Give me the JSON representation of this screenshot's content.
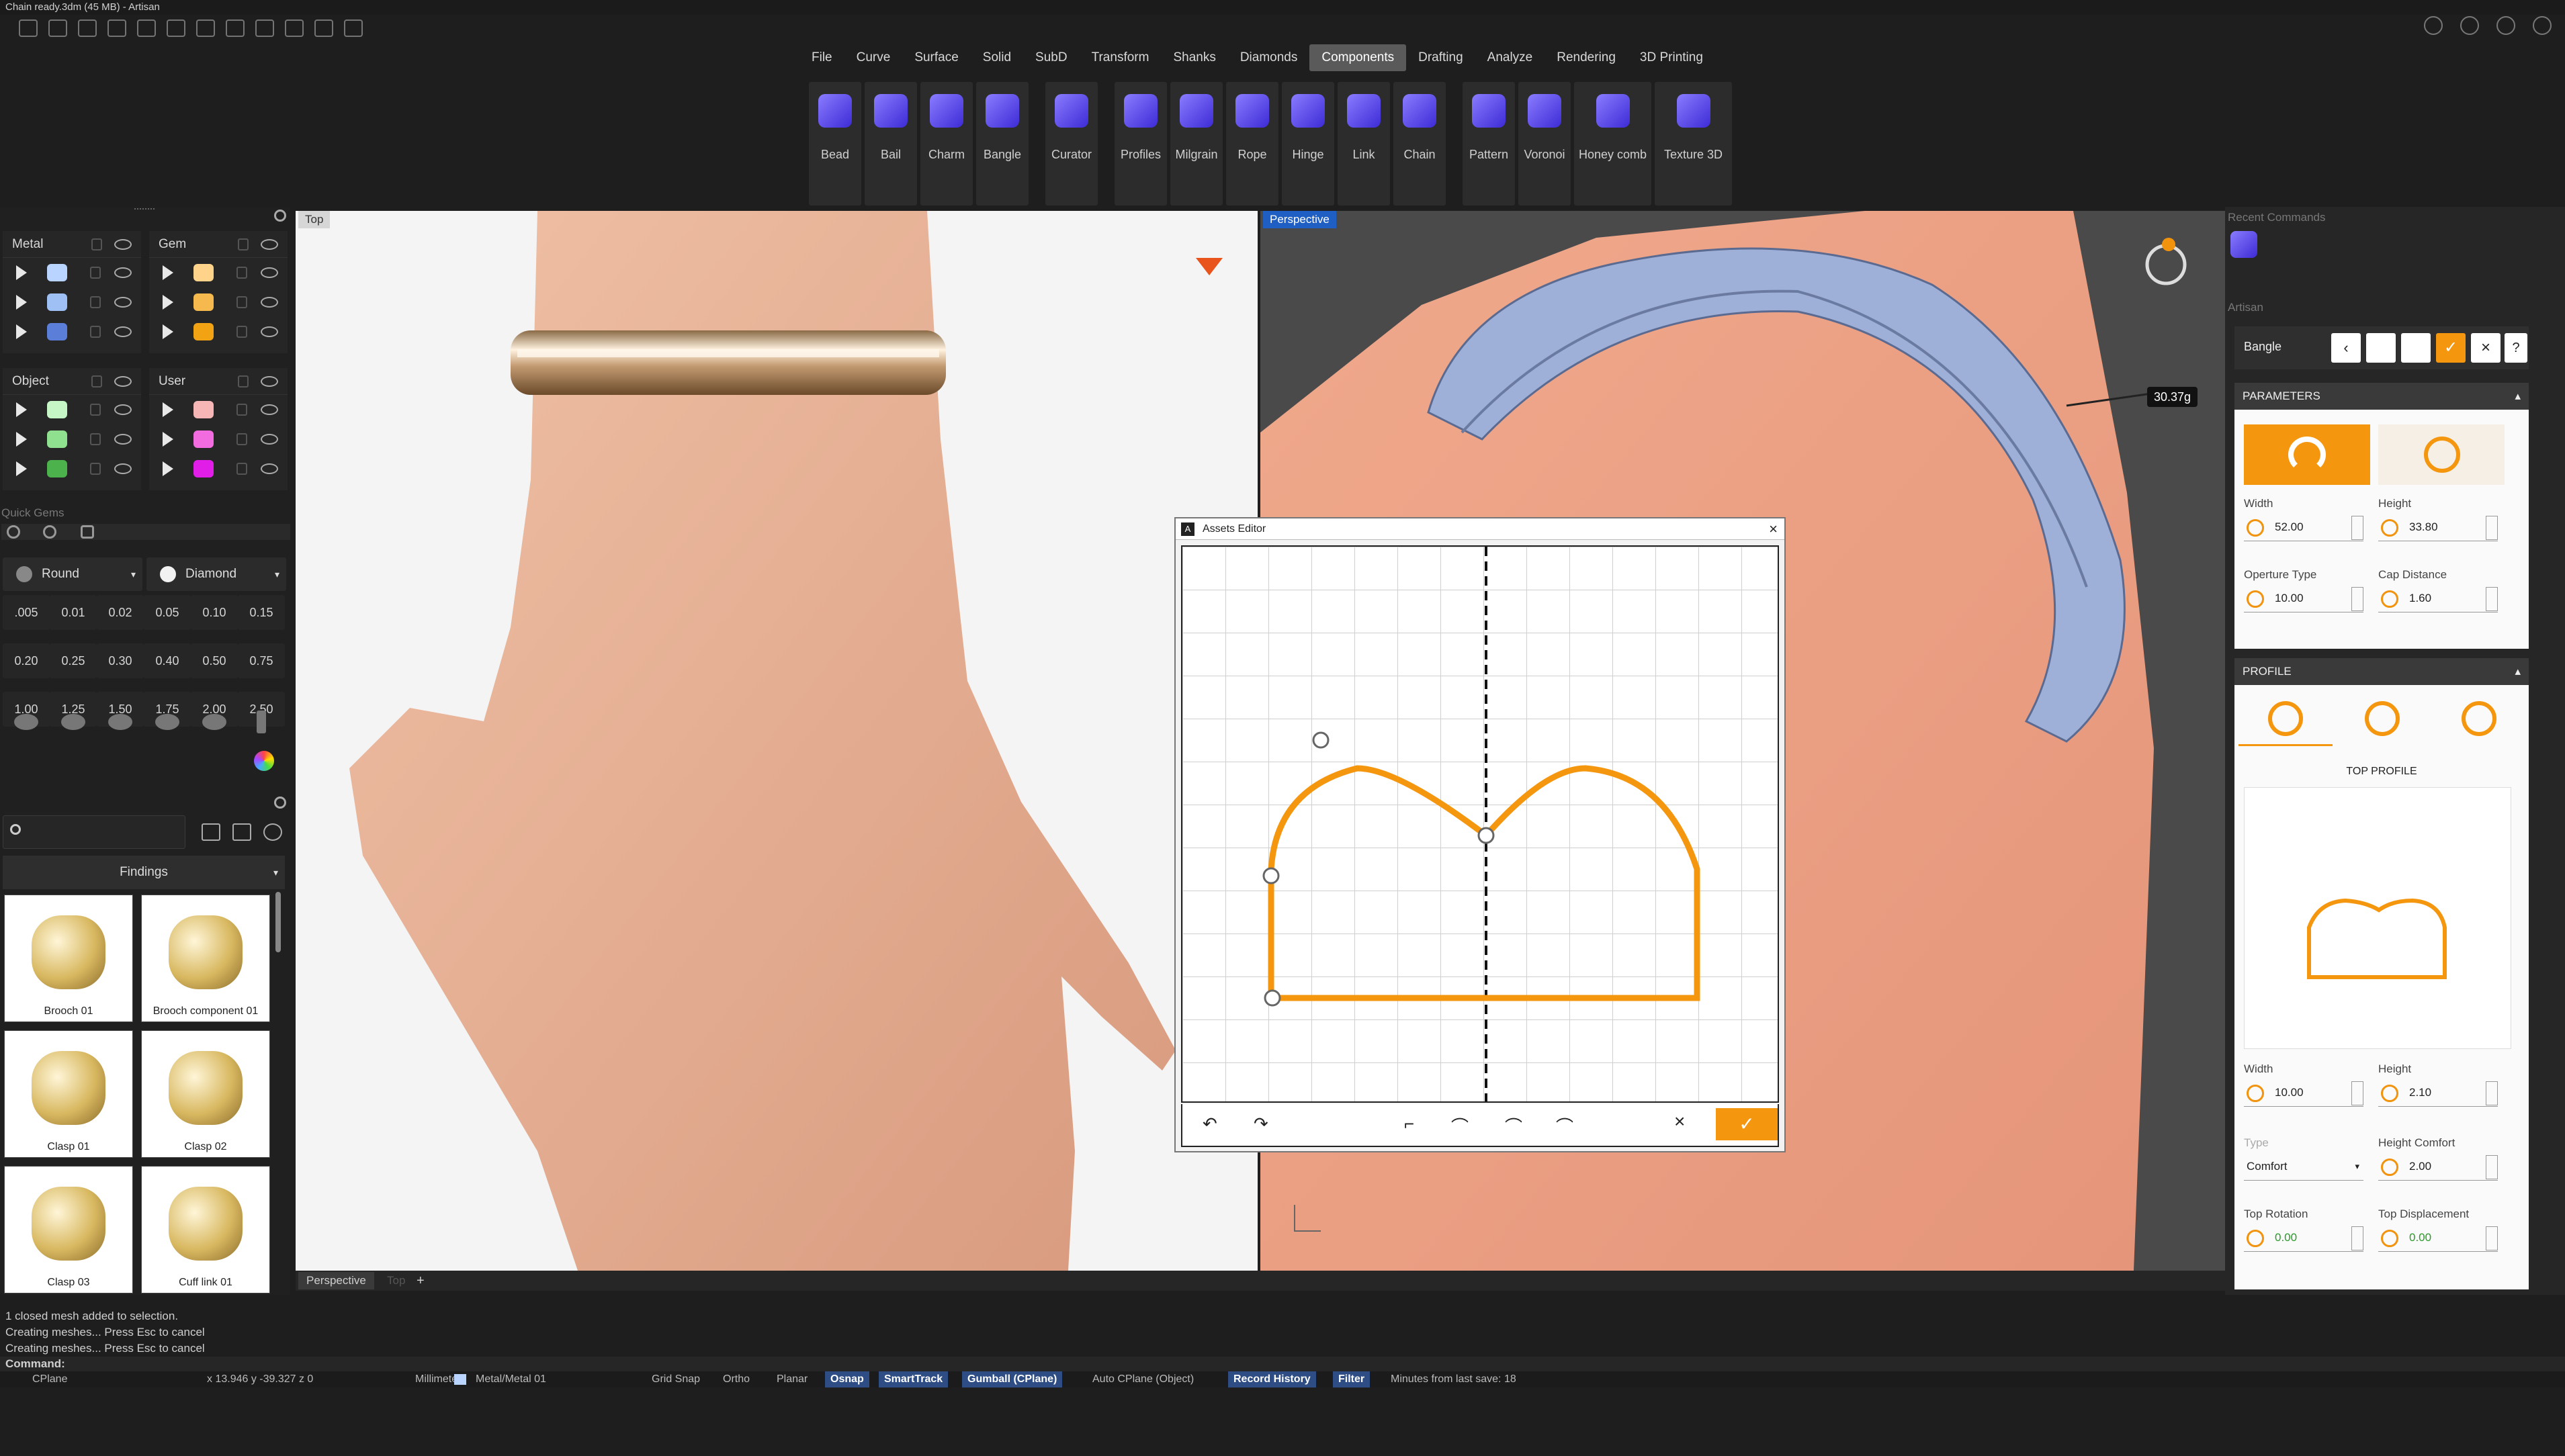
{
  "window": {
    "title": "Chain ready.3dm (45 MB) - Artisan"
  },
  "menu": [
    "File",
    "Curve",
    "Surface",
    "Solid",
    "SubD",
    "Transform",
    "Shanks",
    "Diamonds",
    "Components",
    "Drafting",
    "Analyze",
    "Rendering",
    "3D Printing"
  ],
  "menu_active": "Components",
  "toolbar": [
    {
      "label": "Bead",
      "group": 1
    },
    {
      "label": "Bail",
      "group": 1
    },
    {
      "label": "Charm",
      "group": 1
    },
    {
      "label": "Bangle",
      "group": 1
    },
    {
      "label": "Curator",
      "group": 2
    },
    {
      "label": "Profiles",
      "group": 3
    },
    {
      "label": "Milgrain",
      "group": 3
    },
    {
      "label": "Rope",
      "group": 3
    },
    {
      "label": "Hinge",
      "group": 3
    },
    {
      "label": "Link",
      "group": 3
    },
    {
      "label": "Chain",
      "group": 3
    },
    {
      "label": "Pattern",
      "group": 4
    },
    {
      "label": "Voronoi",
      "group": 4
    },
    {
      "label": "Honey comb",
      "group": 4,
      "wide": true
    },
    {
      "label": "Texture 3D",
      "group": 4,
      "wide": true
    }
  ],
  "layers": {
    "metal": {
      "title": "Metal",
      "colors": [
        "#b9d4ff",
        "#9fc0f5",
        "#5b7fd9"
      ]
    },
    "gem": {
      "title": "Gem",
      "colors": [
        "#ffd38a",
        "#f5b94d",
        "#f2a313"
      ]
    },
    "object": {
      "title": "Object",
      "colors": [
        "#c6f5c6",
        "#8fe08f",
        "#4cb34c"
      ]
    },
    "user": {
      "title": "User",
      "colors": [
        "#f7b6b6",
        "#f26ce0",
        "#e01ee8"
      ]
    }
  },
  "quick_gems": {
    "title": "Quick Gems",
    "shape": "Round",
    "cut": "Diamond",
    "sizes": [
      ".005",
      "0.01",
      "0.02",
      "0.05",
      "0.10",
      "0.15",
      "0.20",
      "0.25",
      "0.30",
      "0.40",
      "0.50",
      "0.75",
      "1.00",
      "1.25",
      "1.50",
      "1.75",
      "2.00",
      "2.50"
    ]
  },
  "library": {
    "category": "Findings",
    "items": [
      "Brooch 01",
      "Brooch component 01",
      "Clasp 01",
      "Clasp 02",
      "Clasp 03",
      "Cuff link 01"
    ]
  },
  "viewports": {
    "left_label": "Top",
    "right_label": "Perspective",
    "weight_label": "30.37g",
    "tabs": [
      "Perspective",
      "Top"
    ]
  },
  "assets_editor": {
    "title": "Assets Editor"
  },
  "right_panel": {
    "recent_title": "Recent Commands",
    "artisan_title": "Artisan",
    "command": "Bangle",
    "parameters": {
      "title": "PARAMETERS",
      "width_label": "Width",
      "width": "52.00",
      "height_label": "Height",
      "height": "33.80",
      "aperture_label": "Operture Type",
      "aperture": "10.00",
      "cap_label": "Cap Distance",
      "cap": "1.60"
    },
    "profile": {
      "title": "PROFILE",
      "sub": "TOP PROFILE",
      "width_label": "Width",
      "width": "10.00",
      "height_label": "Height",
      "height": "2.10",
      "type_label": "Type",
      "type": "Comfort",
      "hc_label": "Height Comfort",
      "hc": "2.00",
      "rot_label": "Top Rotation",
      "rot": "0.00",
      "disp_label": "Top Displacement",
      "disp": "0.00"
    }
  },
  "command_history": [
    "1 closed mesh added to selection.",
    "Creating meshes... Press Esc to cancel",
    "Creating meshes... Press Esc to cancel"
  ],
  "command_prompt": "Command:",
  "status": {
    "cplane": "CPlane",
    "coords": "x 13.946  y -39.327  z 0",
    "units": "Millimeters",
    "layer": "Metal/Metal 01",
    "grid": "Grid Snap",
    "ortho": "Ortho",
    "planar": "Planar",
    "osnap": "Osnap",
    "smarttrack": "SmartTrack",
    "gumball": "Gumball (CPlane)",
    "autocplane": "Auto CPlane (Object)",
    "history": "Record History",
    "filter": "Filter",
    "saved": "Minutes from last save: 18"
  }
}
